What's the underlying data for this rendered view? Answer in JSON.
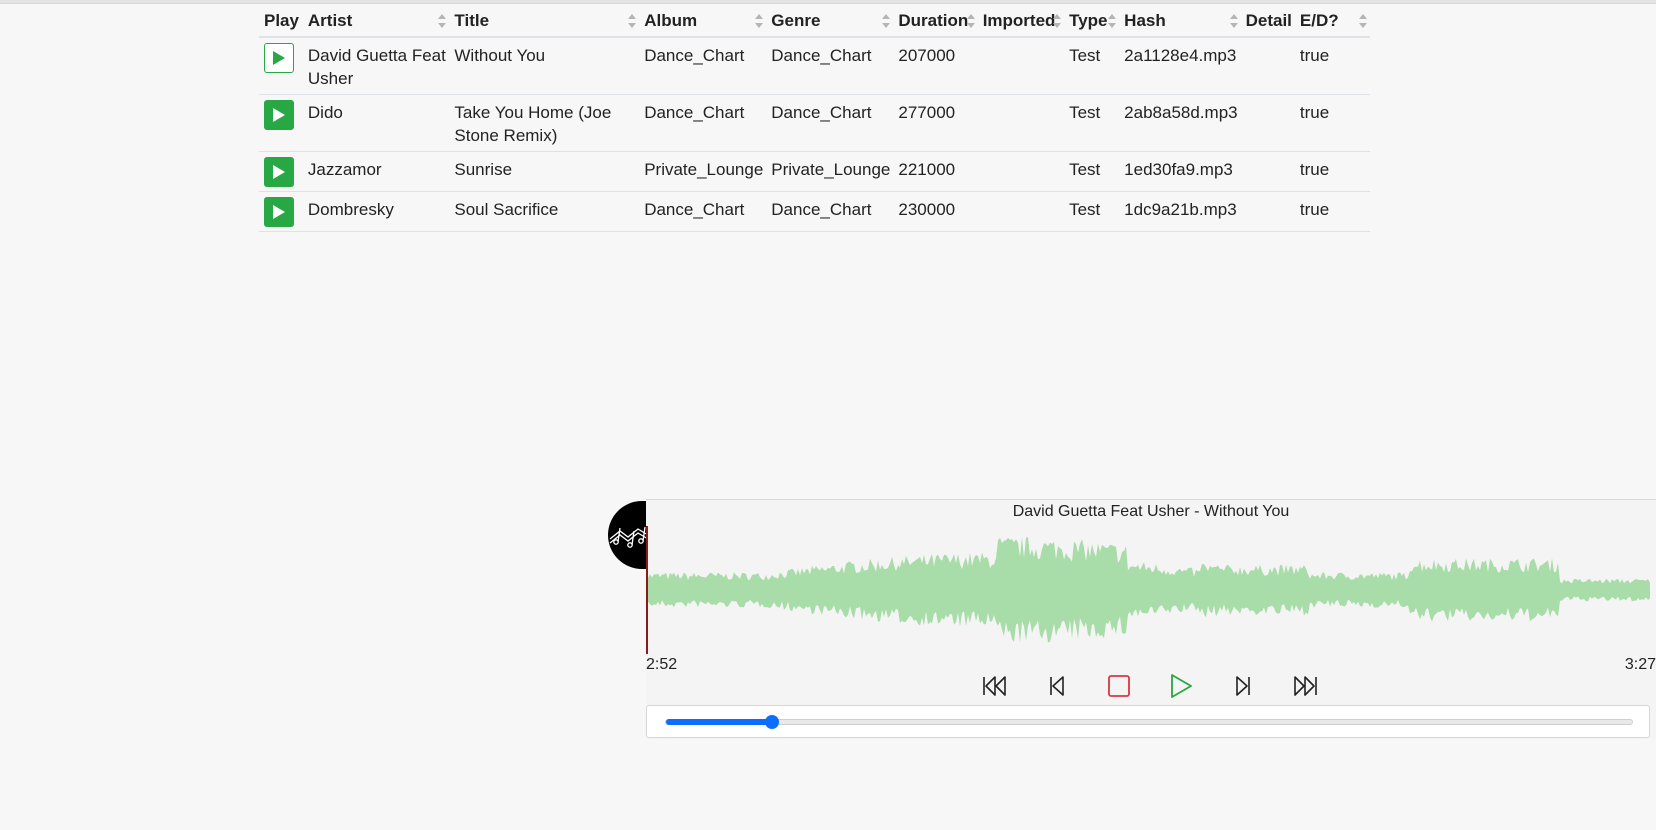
{
  "table": {
    "headers": {
      "play": "Play",
      "artist": "Artist",
      "title": "Title",
      "album": "Album",
      "genre": "Genre",
      "duration": "Duration",
      "imported": "Imported",
      "type": "Type",
      "hash": "Hash",
      "detail": "Detail",
      "ed": "E/D?"
    },
    "rows": [
      {
        "artist": "David Guetta Feat Usher",
        "title": "Without You",
        "album": "Dance_Chart",
        "genre": "Dance_Chart",
        "duration": "207000",
        "imported": "",
        "type": "Test",
        "hash": "2a1128e4.mp3",
        "detail": "",
        "ed": "true",
        "active": true
      },
      {
        "artist": "Dido",
        "title": "Take You Home (Joe Stone Remix)",
        "album": "Dance_Chart",
        "genre": "Dance_Chart",
        "duration": "277000",
        "imported": "",
        "type": "Test",
        "hash": "2ab8a58d.mp3",
        "detail": "",
        "ed": "true",
        "active": false
      },
      {
        "artist": "Jazzamor",
        "title": "Sunrise",
        "album": "Private_Lounge",
        "genre": "Private_Lounge",
        "duration": "221000",
        "imported": "",
        "type": "Test",
        "hash": "1ed30fa9.mp3",
        "detail": "",
        "ed": "true",
        "active": false
      },
      {
        "artist": "Dombresky",
        "title": "Soul Sacrifice",
        "album": "Dance_Chart",
        "genre": "Dance_Chart",
        "duration": "230000",
        "imported": "",
        "type": "Test",
        "hash": "1dc9a21b.mp3",
        "detail": "",
        "ed": "true",
        "active": false
      }
    ]
  },
  "player": {
    "now_playing": "David Guetta Feat Usher - Without You",
    "elapsed": "2:52",
    "total": "3:27",
    "seek_fraction": 0.11,
    "controls": [
      {
        "name": "rewind-to-start-button",
        "icon": "skip-to-start-icon"
      },
      {
        "name": "previous-track-button",
        "icon": "step-back-icon"
      },
      {
        "name": "stop-button",
        "icon": "stop-icon"
      },
      {
        "name": "play-button",
        "icon": "play-icon"
      },
      {
        "name": "next-track-button",
        "icon": "step-forward-icon"
      },
      {
        "name": "fast-forward-to-end-button",
        "icon": "skip-to-end-icon"
      }
    ]
  },
  "colors": {
    "play_green": "#28a745",
    "stop_red": "#dc3545",
    "waveform_green": "#a8dca8",
    "playhead": "#8b1a1a",
    "seek_blue": "#0d6efd"
  }
}
